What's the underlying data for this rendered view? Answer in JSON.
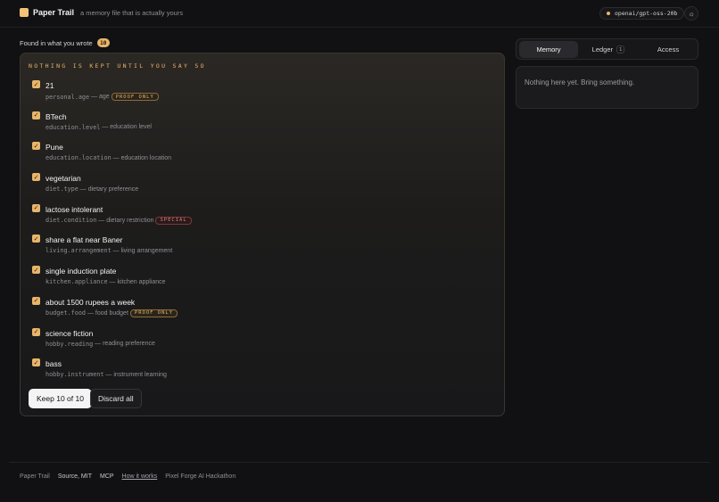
{
  "header": {
    "app_name": "Paper Trail",
    "tagline": "a memory file that is actually yours",
    "model": "openai/gpt-oss-20b",
    "theme_icon": "sun-icon"
  },
  "found": {
    "label": "Found in what you wrote",
    "count": "10"
  },
  "panel": {
    "kicker": "NOTHING IS KEPT UNTIL YOU SAY SO",
    "items": [
      {
        "value": "21",
        "key": "personal.age",
        "desc": "age",
        "tag": "PROOF ONLY"
      },
      {
        "value": "BTech",
        "key": "education.level",
        "desc": "education level",
        "tag": ""
      },
      {
        "value": "Pune",
        "key": "education.location",
        "desc": "education location",
        "tag": ""
      },
      {
        "value": "vegetarian",
        "key": "diet.type",
        "desc": "dietary preference",
        "tag": ""
      },
      {
        "value": "lactose intolerant",
        "key": "diet.condition",
        "desc": "dietary restriction",
        "tag": "SPECIAL"
      },
      {
        "value": "share a flat near Baner",
        "key": "living.arrangement",
        "desc": "living arrangement",
        "tag": ""
      },
      {
        "value": "single induction plate",
        "key": "kitchen.appliance",
        "desc": "kitchen appliance",
        "tag": ""
      },
      {
        "value": "about 1500 rupees a week",
        "key": "budget.food",
        "desc": "food budget",
        "tag": "PROOF ONLY"
      },
      {
        "value": "science fiction",
        "key": "hobby.reading",
        "desc": "reading preference",
        "tag": ""
      },
      {
        "value": "bass",
        "key": "hobby.instrument",
        "desc": "instrument learning",
        "tag": ""
      }
    ],
    "keep_label": "Keep 10 of 10",
    "discard_label": "Discard all"
  },
  "sidebar": {
    "tabs": [
      {
        "label": "Memory",
        "count": ""
      },
      {
        "label": "Ledger",
        "count": "1"
      },
      {
        "label": "Access",
        "count": ""
      }
    ],
    "empty_text": "Nothing here yet. Bring something."
  },
  "footer": {
    "brand": "Paper Trail",
    "source": "Source, MIT",
    "mcp": "MCP",
    "how": "How it works",
    "credit": "Pixel Forge AI Hackathon"
  },
  "colors": {
    "accent": "#e8b56a",
    "background": "#111113",
    "special": "#e07a7a"
  }
}
